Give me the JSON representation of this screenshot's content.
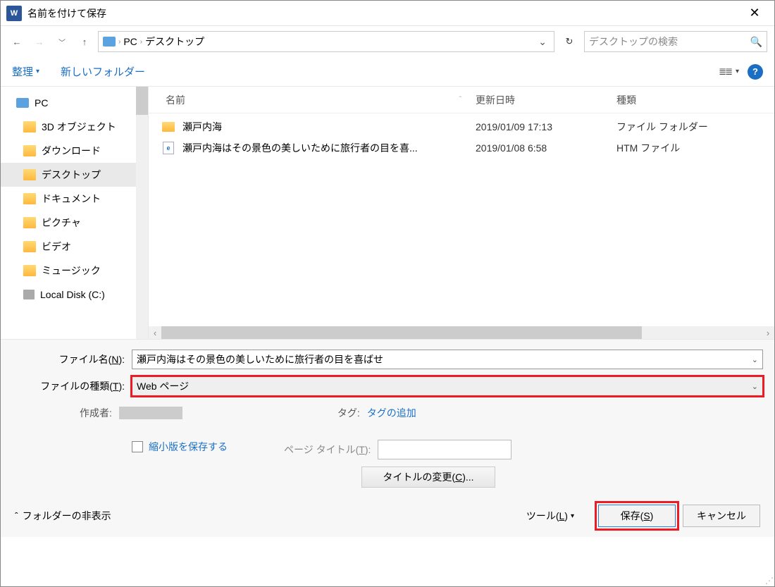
{
  "title": "名前を付けて保存",
  "breadcrumb": {
    "pc": "PC",
    "desktop": "デスクトップ"
  },
  "search": {
    "placeholder": "デスクトップの検索"
  },
  "toolbar": {
    "organize": "整理",
    "new_folder": "新しいフォルダー"
  },
  "columns": {
    "name": "名前",
    "date": "更新日時",
    "type": "種類"
  },
  "tree": {
    "root": "PC",
    "items": [
      "3D オブジェクト",
      "ダウンロード",
      "デスクトップ",
      "ドキュメント",
      "ピクチャ",
      "ビデオ",
      "ミュージック",
      "Local Disk (C:)"
    ]
  },
  "files": [
    {
      "name": "瀬戸内海",
      "date": "2019/01/09 17:13",
      "type": "ファイル フォルダー",
      "kind": "folder"
    },
    {
      "name": "瀬戸内海はその景色の美しいために旅行者の目を喜...",
      "date": "2019/01/08 6:58",
      "type": "HTM ファイル",
      "kind": "html"
    }
  ],
  "form": {
    "filename_label": "ファイル名(N):",
    "filename_value": "瀬戸内海はその景色の美しいために旅行者の目を喜ばせ",
    "filetype_label": "ファイルの種類(T):",
    "filetype_value": "Web ページ",
    "author_label": "作成者:",
    "tag_label": "タグ:",
    "tag_add": "タグの追加",
    "thumbnail_label": "縮小版を保存する",
    "page_title_label": "ページ タイトル(T):",
    "change_title_btn": "タイトルの変更(C)..."
  },
  "footer": {
    "hide_folders": "フォルダーの非表示",
    "tools": "ツール(L)",
    "save": "保存(S)",
    "cancel": "キャンセル"
  }
}
